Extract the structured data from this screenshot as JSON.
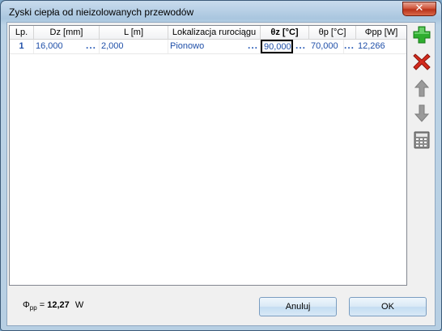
{
  "window": {
    "title": "Zyski ciepła od nieizolowanych przewodów",
    "close_icon": "close-icon"
  },
  "grid": {
    "columns": [
      "Lp.",
      "Dz [mm]",
      "L [m]",
      "Lokalizacja rurociągu",
      "θz [°C]",
      "θp [°C]",
      "Φpp [W]"
    ],
    "rows": [
      {
        "lp": "1",
        "dz": "16,000",
        "l": "2,000",
        "lokalizacja": "Pionowo",
        "tz": "90,000",
        "tp": "70,000",
        "phi": "12,266"
      }
    ],
    "ellipsis": "..."
  },
  "toolbar": {
    "items": [
      "add-icon",
      "delete-icon",
      "arrow-up-icon",
      "arrow-down-icon",
      "calculator-icon"
    ],
    "colors": {
      "add": "#2eae2e",
      "delete": "#d42a1c",
      "disabled": "#9a9a9a"
    }
  },
  "footer": {
    "phi_symbol": "Φ",
    "phi_sub": "pp",
    "phi_eq": " = ",
    "phi_value": "12,27",
    "phi_unit": "W"
  },
  "buttons": {
    "cancel": "Anuluj",
    "ok": "OK"
  }
}
